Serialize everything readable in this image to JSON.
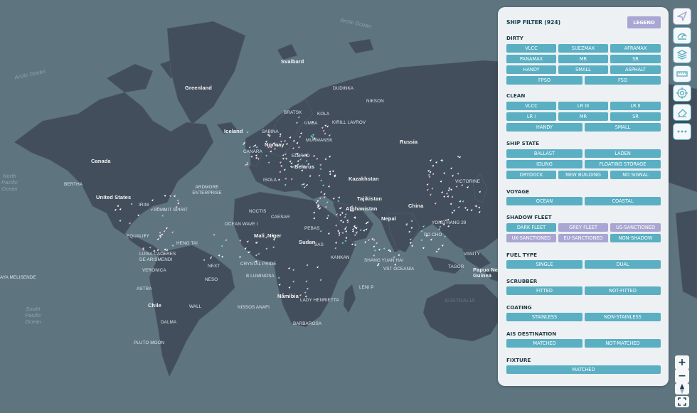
{
  "filter": {
    "title": "SHIP FILTER (924)",
    "legend_label": "LEGEND",
    "sections": {
      "dirty": {
        "title": "DIRTY",
        "buttons": [
          "VLCC",
          "SUEZMAX",
          "AFRAMAX",
          "PANAMAX",
          "MR",
          "SR",
          "HANDY",
          "SMALL",
          "ASPHALT",
          "FPSO",
          "FSO"
        ]
      },
      "clean": {
        "title": "CLEAN",
        "buttons": [
          "VLCC",
          "LR III",
          "LR II",
          "LR I",
          "MR",
          "SR",
          "HANDY",
          "SMALL"
        ]
      },
      "ship_state": {
        "title": "SHIP STATE",
        "buttons": [
          "BALLAST",
          "LADEN",
          "IDLING",
          "FLOATING STORAGE",
          "DRYDOCK",
          "NEW BUILDING",
          "NO SIGNAL"
        ]
      },
      "voyage": {
        "title": "VOYAGE",
        "buttons": [
          "OCEAN",
          "COASTAL"
        ]
      },
      "shadow_fleet": {
        "title": "SHADOW FLEET",
        "buttons": [
          "DARK FLEET",
          "GREY FLEET",
          "US-SANCTIONED",
          "UK-SANCTIONED",
          "EU-SANCTIONED",
          "NON-SHADOW"
        ]
      },
      "fuel_type": {
        "title": "FUEL TYPE",
        "buttons": [
          "SINGLE",
          "DUAL"
        ]
      },
      "scrubber": {
        "title": "SCRUBBER",
        "buttons": [
          "FITTED",
          "NOT-FITTED"
        ]
      },
      "coating": {
        "title": "COATING",
        "buttons": [
          "STAINLESS",
          "NON-STAINLESS"
        ]
      },
      "ais_destination": {
        "title": "AIS DESTINATION",
        "buttons": [
          "MATCHED",
          "NOT-MATCHED"
        ]
      },
      "fixture": {
        "title": "FIXTURE",
        "buttons": [
          "MATCHED"
        ]
      }
    }
  },
  "toolbar": {
    "icons": [
      "navigation-icon",
      "weather-icon",
      "layers-icon",
      "ruler-icon",
      "target-icon",
      "eraser-icon",
      "more-icon"
    ],
    "zoom_in": "+",
    "zoom_out": "−"
  },
  "map": {
    "oceans": {
      "arctic": "Arctic Ocean",
      "arctic_west": "Arctic Ocean",
      "north_pacific": "North\nPacific\nOcean",
      "south_pacific": "South\nPacific\nOcean",
      "australia": "AUSTRALIA"
    },
    "countries": {
      "greenland": "Greenland",
      "svalbard": "Svalbard",
      "iceland": "Iceland",
      "norway": "Norway",
      "russia": "Russia",
      "canada": "Canada",
      "united_states": "United States",
      "belarus": "Belarus",
      "kazakhstan": "Kazakhstan",
      "tajikistan": "Tajikistan",
      "afghanistan": "Afghanistan",
      "china": "China",
      "nepal": "Nepal",
      "mali": "Mali",
      "niger": "Niger",
      "sudan": "Sudan",
      "namibia": "Namibia",
      "chile": "Chile",
      "papua": "Papua New\nGuinea"
    },
    "ships": {
      "s1": "DUDINKA",
      "s2": "NIKSON",
      "s3": "KOLA",
      "s4": "UMBA",
      "s5": "KIRILL LAVROV",
      "s6": "BRATSK",
      "s7": "SABINA",
      "s8": "MURMANSK",
      "s9": "CANARA",
      "s10": "ELBRAD",
      "s11": "BERTHA",
      "s12": "ARDMORE ENTERPRISE",
      "s13": "SUMMIT SPIRIT",
      "s14": "NOCTIS",
      "s15": "OCEAN WAVE I",
      "s16": "EQUALITY",
      "s17": "HENG TAI",
      "s18": "LUISA CACERES DE ARISMENDI",
      "s19": "VERONICA",
      "s20": "AYA MELISENDE",
      "s21": "ASTRA",
      "s22": "NEXT",
      "s23": "NESO",
      "s24": "CRYSTAL PRIDE",
      "s25": "B LUMINOSA",
      "s26": "WALL",
      "s27": "DALMA",
      "s28": "NISSOS ANAFI",
      "s29": "LADY HENRIETTA",
      "s30": "BARBAROSA",
      "s31": "PLUTO MOON",
      "s32": "CAESAR",
      "s33": "PEBAS",
      "s34": "SHANG YUAN HAI",
      "s35": "VST OCEANIA",
      "s36": "LENI P",
      "s37": "TAGOR",
      "s38": "VANITY",
      "s39": "YONG HANG 29",
      "s40": "VICTORINE",
      "s41": "PO CHO",
      "s42": "KANKAN",
      "s43": "IRINI",
      "s44": "SAS",
      "s45": "ISOLA"
    }
  }
}
